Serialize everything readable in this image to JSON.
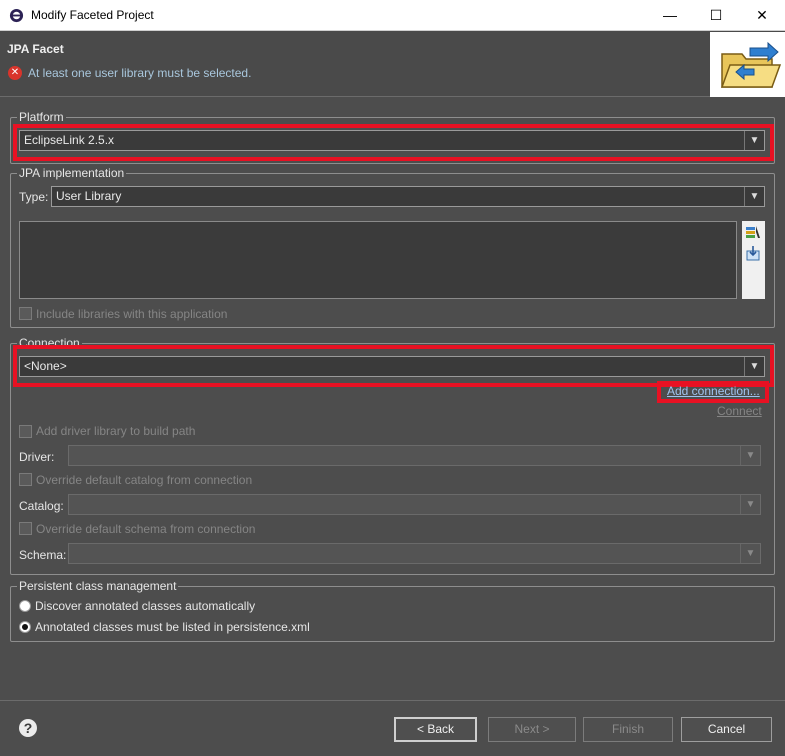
{
  "window": {
    "title": "Modify Faceted Project",
    "minimize": "—",
    "maximize": "☐",
    "close": "✕"
  },
  "header": {
    "title": "JPA Facet",
    "error_message": "At least one user library must be selected."
  },
  "platform": {
    "legend": "Platform",
    "selected": "EclipseLink 2.5.x"
  },
  "jpa_impl": {
    "legend": "JPA implementation",
    "type_label": "Type:",
    "type_selected": "User Library",
    "include_label": "Include libraries with this application"
  },
  "connection": {
    "legend": "Connection",
    "selected": "<None>",
    "add_connection": "Add connection...",
    "connect": "Connect",
    "add_driver_label": "Add driver library to build path",
    "driver_label": "Driver:",
    "override_catalog_label": "Override default catalog from connection",
    "catalog_label": "Catalog:",
    "override_schema_label": "Override default schema from connection",
    "schema_label": "Schema:"
  },
  "persistence": {
    "legend": "Persistent class management",
    "option_discover": "Discover annotated classes automatically",
    "option_listed": "Annotated classes must be listed in persistence.xml",
    "selected": "listed"
  },
  "footer": {
    "back": "< Back",
    "next": "Next >",
    "finish": "Finish",
    "cancel": "Cancel"
  },
  "colors": {
    "highlight": "#e81123",
    "background": "#4d4d4d",
    "error": "#d9342b"
  }
}
